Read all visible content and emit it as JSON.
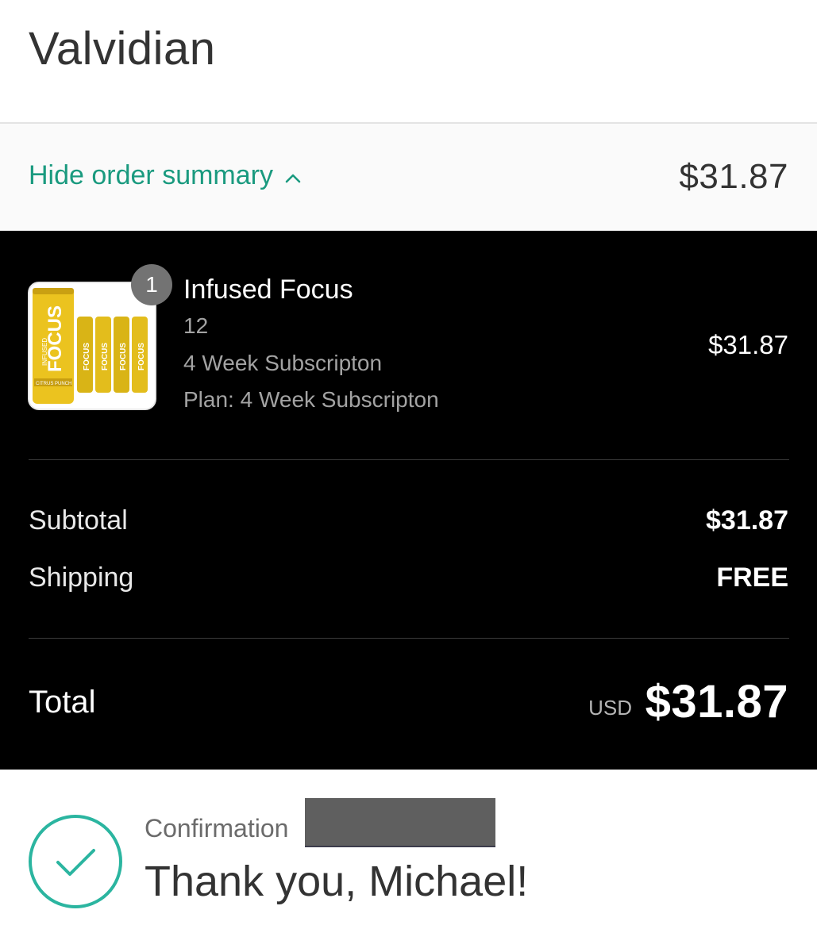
{
  "store": {
    "name": "Valvidian"
  },
  "summary_bar": {
    "toggle_label": "Hide order summary",
    "total": "$31.87"
  },
  "line_item": {
    "quantity": "1",
    "name": "Infused Focus",
    "variant": "12",
    "subscription": "4 Week Subscripton",
    "plan": "Plan: 4 Week Subscripton",
    "price": "$31.87",
    "image_text": [
      "INFUSED",
      "FOCUS",
      "CITRUS PUNCH"
    ]
  },
  "totals": {
    "subtotal_label": "Subtotal",
    "subtotal_value": "$31.87",
    "shipping_label": "Shipping",
    "shipping_value": "FREE",
    "total_label": "Total",
    "currency": "USD",
    "total_value": "$31.87"
  },
  "confirmation": {
    "label": "Confirmation",
    "thank_you": "Thank you, Michael!"
  },
  "colors": {
    "accent": "#1a9a7f",
    "check": "#2bb5a0",
    "panel": "#000000",
    "can_yellow": "#e7c21a"
  },
  "icons": [
    "chevron-up-icon",
    "check-circle-icon",
    "product-thumbnail"
  ]
}
